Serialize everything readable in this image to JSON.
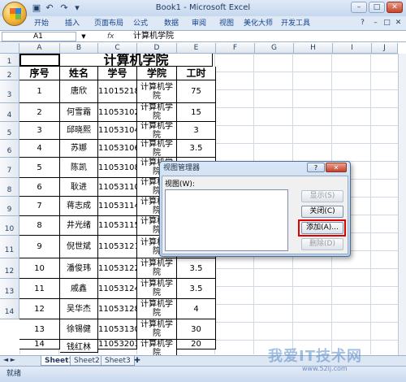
{
  "window": {
    "title": "Book1 - Microsoft Excel"
  },
  "ribbon_tabs": [
    "开始",
    "插入",
    "页面布局",
    "公式",
    "数据",
    "审阅",
    "视图",
    "美化大师",
    "开发工具"
  ],
  "formula_bar": {
    "name_box": "A1",
    "fx": "fx",
    "value": "计算机学院"
  },
  "columns": [
    "A",
    "B",
    "C",
    "D",
    "E",
    "F",
    "G",
    "H",
    "I",
    "J"
  ],
  "rows": [
    "1",
    "2",
    "3",
    "4",
    "5",
    "6",
    "7",
    "8",
    "9",
    "10",
    "11",
    "12",
    "13",
    "14"
  ],
  "sheet": {
    "title": "计算机学院",
    "headers": [
      "序号",
      "姓名",
      "学号",
      "学院",
      "工时"
    ],
    "records": [
      {
        "no": "1",
        "name": "唐欣",
        "id": "11015218",
        "college": "计算机学院",
        "hours": "75"
      },
      {
        "no": "2",
        "name": "何雪霜",
        "id": "11053102",
        "college": "计算机学院",
        "hours": "15"
      },
      {
        "no": "3",
        "name": "邱晓熙",
        "id": "11053104",
        "college": "计算机学院",
        "hours": "3"
      },
      {
        "no": "4",
        "name": "苏娜",
        "id": "11053106",
        "college": "计算机学院",
        "hours": "3.5"
      },
      {
        "no": "5",
        "name": "陈凯",
        "id": "11053108",
        "college": "计算机学院",
        "hours": ""
      },
      {
        "no": "6",
        "name": "耿进",
        "id": "11053110",
        "college": "计算机学院",
        "hours": ""
      },
      {
        "no": "7",
        "name": "蒋志成",
        "id": "11053114",
        "college": "计算机学院",
        "hours": ""
      },
      {
        "no": "8",
        "name": "井光绪",
        "id": "11053115",
        "college": "计算机学院",
        "hours": ""
      },
      {
        "no": "9",
        "name": "倪世斌",
        "id": "11053121",
        "college": "计算机学院",
        "hours": ""
      },
      {
        "no": "10",
        "name": "潘俊玮",
        "id": "11053122",
        "college": "计算机学院",
        "hours": "3.5"
      },
      {
        "no": "11",
        "name": "戚鑫",
        "id": "11053124",
        "college": "计算机学院",
        "hours": "3.5"
      },
      {
        "no": "12",
        "name": "吴华杰",
        "id": "11053128",
        "college": "计算机学院",
        "hours": "4"
      },
      {
        "no": "13",
        "name": "徐锡健",
        "id": "11053130",
        "college": "计算机学院",
        "hours": "30"
      },
      {
        "no": "14",
        "name": "钱红林",
        "id": "11053203",
        "college": "计算机学院",
        "hours": "20"
      }
    ]
  },
  "sheet_tabs": [
    "Sheet1",
    "Sheet2",
    "Sheet3"
  ],
  "status": {
    "ready": "就绪"
  },
  "dialog": {
    "title": "视图管理器",
    "views_label": "视图(W):",
    "show_btn": "显示(S)",
    "close_btn": "关闭(C)",
    "add_btn": "添加(A)...",
    "delete_btn": "删除(D)",
    "help": "?",
    "close_x": "✕"
  },
  "watermark": {
    "text": "我爱IT技术网",
    "sub": "www.52ij.com"
  },
  "colors": {
    "highlight": "#e10000",
    "ribbon_text": "#15428b"
  }
}
